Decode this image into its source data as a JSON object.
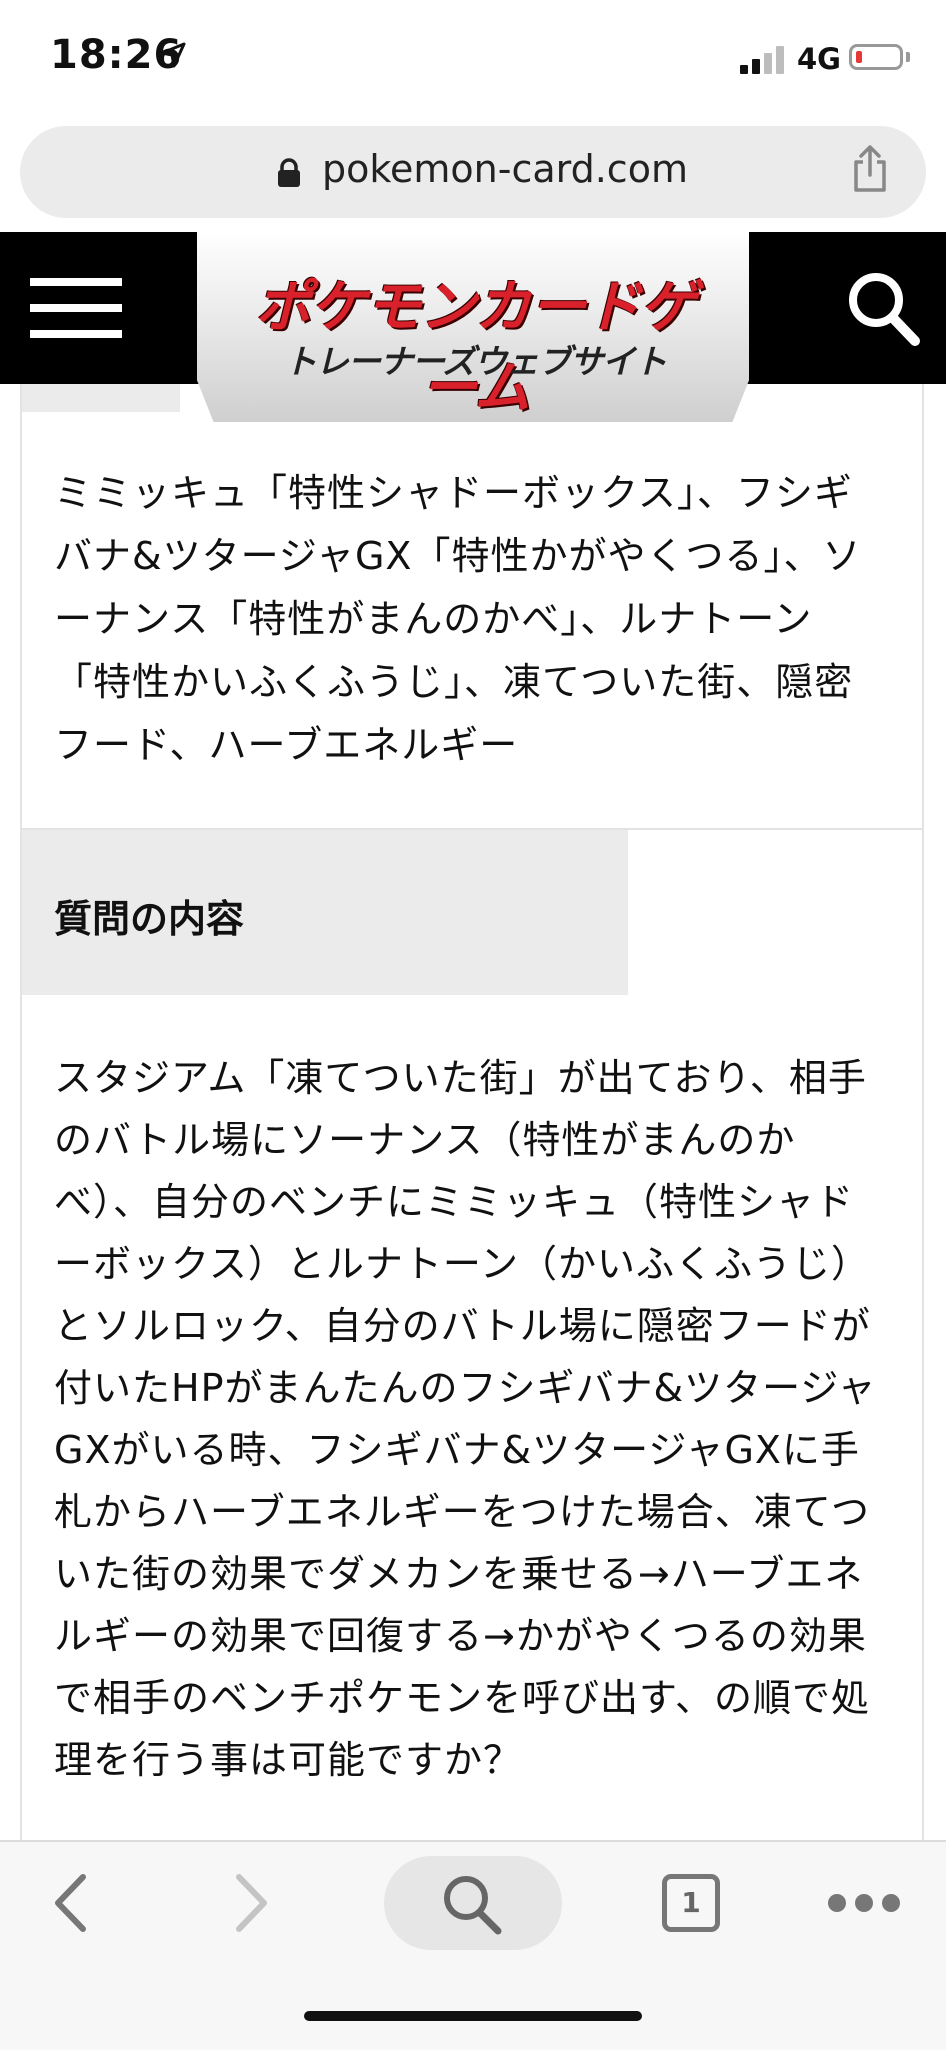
{
  "status_bar": {
    "time": "18:26",
    "network": "4G",
    "battery_color": "#e53935"
  },
  "browser": {
    "url": "pokemon-card.com",
    "open_tabs": "1"
  },
  "site_header": {
    "logo_title": "ポケモンカードゲーム",
    "logo_subtitle": "トレーナーズウェブサイト",
    "icons": [
      "menu-icon",
      "search-icon"
    ]
  },
  "content": {
    "cards_text": "ミミッキュ「特性シャドーボックス」、フシギバナ&ツタージャGX「特性かがやくつる」、ソーナンス「特性がまんのかべ」、ルナトーン「特性かいふくふうじ」、凍てついた街、隠密フード、ハーブエネルギー",
    "question_label": "質問の内容",
    "question_text": "スタジアム「凍てついた街」が出ており、相手のバトル場にソーナンス（特性がまんのかべ）、自分のベンチにミミッキュ（特性シャドーボックス）とルナトーン（かいふくふうじ）とソルロック、自分のバトル場に隠密フードが付いたHPがまんたんのフシギバナ&ツタージャGXがいる時、フシギバナ&ツタージャGXに手札からハーブエネルギーをつけた場合、凍てついた街の効果でダメカンを乗せる→ハーブエネルギーの効果で回復する→かがやくつるの効果で相手のベンチポケモンを呼び出す、の順で処理を行う事は可能ですか？"
  },
  "toolbar": {
    "icons": [
      "back-icon",
      "forward-icon",
      "search-icon",
      "tabs-icon",
      "more-icon"
    ]
  }
}
